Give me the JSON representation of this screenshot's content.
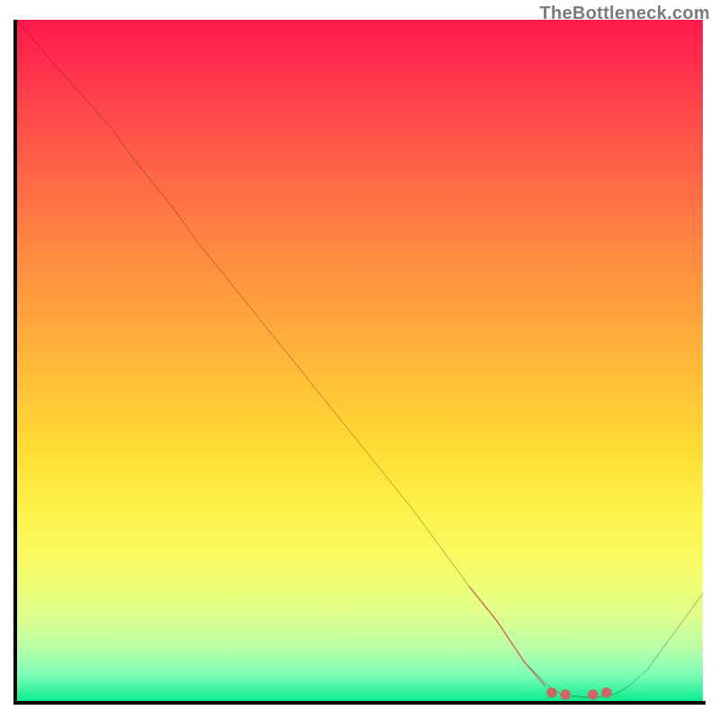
{
  "watermark": "TheBottleneck.com",
  "chart_data": {
    "type": "line",
    "title": "",
    "xlabel": "",
    "ylabel": "",
    "xlim": [
      0,
      100
    ],
    "ylim": [
      0,
      100
    ],
    "series": [
      {
        "name": "curve",
        "x": [
          0,
          6,
          14,
          22,
          26,
          34,
          42,
          50,
          58,
          66,
          70,
          74,
          78,
          83,
          88,
          92,
          100
        ],
        "y": [
          100,
          93,
          84,
          74,
          68,
          58,
          48,
          38,
          28,
          17,
          12,
          6,
          2,
          1,
          1,
          5,
          16
        ]
      }
    ],
    "highlight_segment": {
      "description": "bold salmon stroke over the lower dip",
      "x": [
        66,
        70,
        74,
        77
      ],
      "y": [
        17,
        12,
        6,
        2.5
      ]
    },
    "highlight_dots": {
      "description": "salmon dots along the valley floor",
      "points": [
        {
          "x": 78,
          "y": 1.5
        },
        {
          "x": 80,
          "y": 1.2
        },
        {
          "x": 84,
          "y": 1.2
        },
        {
          "x": 86,
          "y": 1.5
        }
      ]
    },
    "colors": {
      "curve": "#161616",
      "highlight": "#d16464",
      "gradient_top": "#ff1a4b",
      "gradient_mid": "#ffdd34",
      "gradient_bottom": "#00e889"
    }
  }
}
